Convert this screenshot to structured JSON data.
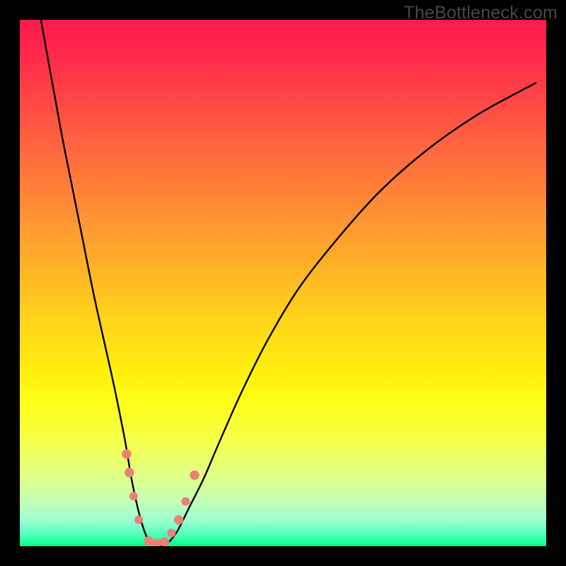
{
  "watermark": "TheBottleneck.com",
  "chart_data": {
    "type": "line",
    "title": "",
    "xlabel": "",
    "ylabel": "",
    "xlim": [
      0,
      100
    ],
    "ylim": [
      0,
      100
    ],
    "series": [
      {
        "name": "curve",
        "x": [
          4,
          6,
          8,
          10,
          12,
          14,
          16,
          18,
          20,
          21,
          22,
          23,
          24,
          25,
          26.5,
          28,
          30,
          32,
          35,
          38,
          42,
          47,
          53,
          60,
          68,
          77,
          87,
          98
        ],
        "y": [
          100,
          89,
          78,
          68,
          58,
          48,
          39,
          30,
          20,
          14,
          9,
          5,
          2,
          0.5,
          0,
          0.5,
          3,
          7,
          13,
          20,
          29,
          39,
          49,
          58,
          67,
          75,
          82,
          88
        ]
      }
    ],
    "markers": [
      {
        "x": 20.3,
        "y": 17.5,
        "r": 1.0
      },
      {
        "x": 20.8,
        "y": 14.0,
        "r": 1.0
      },
      {
        "x": 21.6,
        "y": 9.5,
        "r": 0.9
      },
      {
        "x": 22.6,
        "y": 5,
        "r": 0.9
      },
      {
        "x": 24.5,
        "y": 1.0,
        "r": 1.0
      },
      {
        "x": 26.0,
        "y": 0.5,
        "r": 1.0
      },
      {
        "x": 27.5,
        "y": 0.8,
        "r": 1.0
      },
      {
        "x": 28.8,
        "y": 2.5,
        "r": 0.9
      },
      {
        "x": 30.2,
        "y": 5.0,
        "r": 1.0
      },
      {
        "x": 31.5,
        "y": 8.5,
        "r": 0.9
      },
      {
        "x": 33.2,
        "y": 13.5,
        "r": 1.0
      }
    ],
    "colors": {
      "curve": "#000000",
      "marker": "#e98177"
    }
  }
}
